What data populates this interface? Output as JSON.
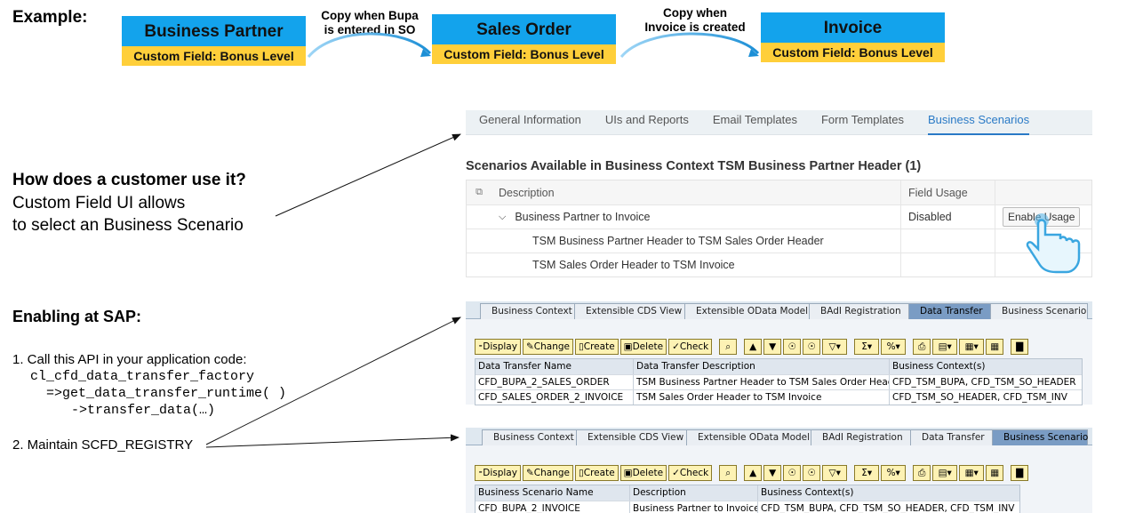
{
  "example": {
    "title": "Example:",
    "boxes": [
      {
        "title": "Business Partner",
        "field": "Custom Field: Bonus Level"
      },
      {
        "title": "Sales Order",
        "field": "Custom Field: Bonus Level"
      },
      {
        "title": "Invoice",
        "field": "Custom Field: Bonus Level"
      }
    ],
    "captions": [
      {
        "line1": "Copy when Bupa",
        "line2": "is entered in SO"
      },
      {
        "line1": "Copy when",
        "line2": "Invoice is created"
      }
    ]
  },
  "usage": {
    "question": "How  does a customer use it?",
    "line1": "Custom Field UI allows",
    "line2": "to select an Business Scenario"
  },
  "enabling": {
    "title": "Enabling at SAP:",
    "step1": "1. Call this API in your  application code:",
    "code1": "cl_cfd_data_transfer_factory",
    "code2": "=>get_data_transfer_runtime( )",
    "code3": "->transfer_data(…)",
    "step2": "2. Maintain SCFD_REGISTRY"
  },
  "fiori": {
    "tabs": [
      "General Information",
      "UIs and Reports",
      "Email Templates",
      "Form Templates",
      "Business Scenarios"
    ],
    "selected_tab": "Business Scenarios",
    "heading": "Scenarios Available in Business Context TSM Business Partner Header (1)",
    "columns": [
      "Description",
      "Field Usage"
    ],
    "rows": [
      {
        "description": "Business Partner to Invoice",
        "usage": "Disabled",
        "action": "Enable Usage"
      },
      {
        "description": "TSM Business Partner Header to TSM Sales Order Header"
      },
      {
        "description": "TSM Sales Order Header to TSM Invoice"
      }
    ]
  },
  "gui1": {
    "tabs": [
      "Business Context",
      "Extensible CDS View",
      "Extensible OData Model",
      "BAdI Registration",
      "Data Transfer",
      "Business Scenario"
    ],
    "selected_tab": "Data Transfer",
    "toolbar": {
      "display": "Display",
      "change": "Change",
      "create": "Create",
      "delete": "Delete",
      "check": "Check"
    },
    "columns": [
      "Data Transfer Name",
      "Data Transfer Description",
      "Business Context(s)"
    ],
    "rows": [
      [
        "CFD_BUPA_2_SALES_ORDER",
        "TSM Business Partner Header to TSM Sales Order Header",
        "CFD_TSM_BUPA, CFD_TSM_SO_HEADER"
      ],
      [
        "CFD_SALES_ORDER_2_INVOICE",
        "TSM Sales Order Header to TSM Invoice",
        "CFD_TSM_SO_HEADER, CFD_TSM_INV"
      ]
    ]
  },
  "gui2": {
    "tabs": [
      "Business Context",
      "Extensible CDS View",
      "Extensible OData Model",
      "BAdI Registration",
      "Data Transfer",
      "Business Scenario"
    ],
    "selected_tab": "Business Scenario",
    "toolbar": {
      "display": "Display",
      "change": "Change",
      "create": "Create",
      "delete": "Delete",
      "check": "Check"
    },
    "columns": [
      "Business Scenario Name",
      "Description",
      "Business Context(s)"
    ],
    "rows": [
      [
        "CFD_BUPA_2_INVOICE",
        "Business Partner to Invoice",
        "CFD_TSM_BUPA, CFD_TSM_SO_HEADER, CFD_TSM_INV"
      ]
    ]
  },
  "colors": {
    "box_blue": "#13a3ec",
    "box_yellow": "#ffcf3a",
    "fiori_accent": "#2a7ac6",
    "gui_selected_tab": "#7a9cc4"
  }
}
